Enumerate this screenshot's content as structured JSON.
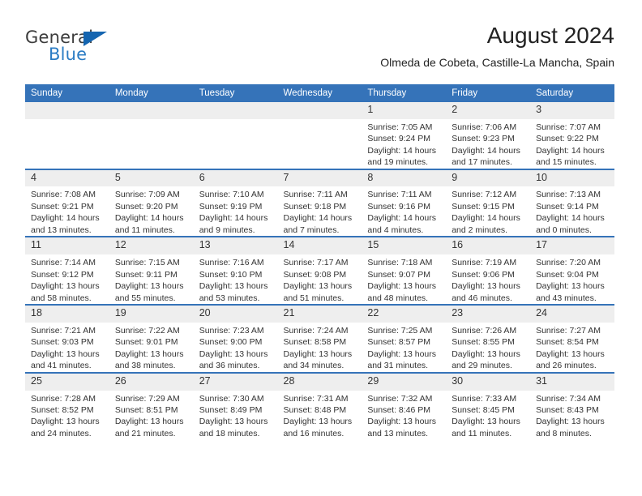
{
  "brand": {
    "name_part1": "General",
    "name_part2": "Blue",
    "triangle_color": "#1565b0",
    "blue_color": "#2b7cc4"
  },
  "header": {
    "title": "August 2024",
    "subtitle": "Olmeda de Cobeta, Castille-La Mancha, Spain"
  },
  "theme": {
    "header_blue": "#3573b9",
    "daynum_band": "#eeeeee",
    "text": "#333333"
  },
  "calendar": {
    "weekday_headers": [
      "Sunday",
      "Monday",
      "Tuesday",
      "Wednesday",
      "Thursday",
      "Friday",
      "Saturday"
    ],
    "weeks": [
      [
        {
          "day": "",
          "lines": []
        },
        {
          "day": "",
          "lines": []
        },
        {
          "day": "",
          "lines": []
        },
        {
          "day": "",
          "lines": []
        },
        {
          "day": "1",
          "lines": [
            "Sunrise: 7:05 AM",
            "Sunset: 9:24 PM",
            "Daylight: 14 hours",
            "and 19 minutes."
          ]
        },
        {
          "day": "2",
          "lines": [
            "Sunrise: 7:06 AM",
            "Sunset: 9:23 PM",
            "Daylight: 14 hours",
            "and 17 minutes."
          ]
        },
        {
          "day": "3",
          "lines": [
            "Sunrise: 7:07 AM",
            "Sunset: 9:22 PM",
            "Daylight: 14 hours",
            "and 15 minutes."
          ]
        }
      ],
      [
        {
          "day": "4",
          "lines": [
            "Sunrise: 7:08 AM",
            "Sunset: 9:21 PM",
            "Daylight: 14 hours",
            "and 13 minutes."
          ]
        },
        {
          "day": "5",
          "lines": [
            "Sunrise: 7:09 AM",
            "Sunset: 9:20 PM",
            "Daylight: 14 hours",
            "and 11 minutes."
          ]
        },
        {
          "day": "6",
          "lines": [
            "Sunrise: 7:10 AM",
            "Sunset: 9:19 PM",
            "Daylight: 14 hours",
            "and 9 minutes."
          ]
        },
        {
          "day": "7",
          "lines": [
            "Sunrise: 7:11 AM",
            "Sunset: 9:18 PM",
            "Daylight: 14 hours",
            "and 7 minutes."
          ]
        },
        {
          "day": "8",
          "lines": [
            "Sunrise: 7:11 AM",
            "Sunset: 9:16 PM",
            "Daylight: 14 hours",
            "and 4 minutes."
          ]
        },
        {
          "day": "9",
          "lines": [
            "Sunrise: 7:12 AM",
            "Sunset: 9:15 PM",
            "Daylight: 14 hours",
            "and 2 minutes."
          ]
        },
        {
          "day": "10",
          "lines": [
            "Sunrise: 7:13 AM",
            "Sunset: 9:14 PM",
            "Daylight: 14 hours",
            "and 0 minutes."
          ]
        }
      ],
      [
        {
          "day": "11",
          "lines": [
            "Sunrise: 7:14 AM",
            "Sunset: 9:12 PM",
            "Daylight: 13 hours",
            "and 58 minutes."
          ]
        },
        {
          "day": "12",
          "lines": [
            "Sunrise: 7:15 AM",
            "Sunset: 9:11 PM",
            "Daylight: 13 hours",
            "and 55 minutes."
          ]
        },
        {
          "day": "13",
          "lines": [
            "Sunrise: 7:16 AM",
            "Sunset: 9:10 PM",
            "Daylight: 13 hours",
            "and 53 minutes."
          ]
        },
        {
          "day": "14",
          "lines": [
            "Sunrise: 7:17 AM",
            "Sunset: 9:08 PM",
            "Daylight: 13 hours",
            "and 51 minutes."
          ]
        },
        {
          "day": "15",
          "lines": [
            "Sunrise: 7:18 AM",
            "Sunset: 9:07 PM",
            "Daylight: 13 hours",
            "and 48 minutes."
          ]
        },
        {
          "day": "16",
          "lines": [
            "Sunrise: 7:19 AM",
            "Sunset: 9:06 PM",
            "Daylight: 13 hours",
            "and 46 minutes."
          ]
        },
        {
          "day": "17",
          "lines": [
            "Sunrise: 7:20 AM",
            "Sunset: 9:04 PM",
            "Daylight: 13 hours",
            "and 43 minutes."
          ]
        }
      ],
      [
        {
          "day": "18",
          "lines": [
            "Sunrise: 7:21 AM",
            "Sunset: 9:03 PM",
            "Daylight: 13 hours",
            "and 41 minutes."
          ]
        },
        {
          "day": "19",
          "lines": [
            "Sunrise: 7:22 AM",
            "Sunset: 9:01 PM",
            "Daylight: 13 hours",
            "and 38 minutes."
          ]
        },
        {
          "day": "20",
          "lines": [
            "Sunrise: 7:23 AM",
            "Sunset: 9:00 PM",
            "Daylight: 13 hours",
            "and 36 minutes."
          ]
        },
        {
          "day": "21",
          "lines": [
            "Sunrise: 7:24 AM",
            "Sunset: 8:58 PM",
            "Daylight: 13 hours",
            "and 34 minutes."
          ]
        },
        {
          "day": "22",
          "lines": [
            "Sunrise: 7:25 AM",
            "Sunset: 8:57 PM",
            "Daylight: 13 hours",
            "and 31 minutes."
          ]
        },
        {
          "day": "23",
          "lines": [
            "Sunrise: 7:26 AM",
            "Sunset: 8:55 PM",
            "Daylight: 13 hours",
            "and 29 minutes."
          ]
        },
        {
          "day": "24",
          "lines": [
            "Sunrise: 7:27 AM",
            "Sunset: 8:54 PM",
            "Daylight: 13 hours",
            "and 26 minutes."
          ]
        }
      ],
      [
        {
          "day": "25",
          "lines": [
            "Sunrise: 7:28 AM",
            "Sunset: 8:52 PM",
            "Daylight: 13 hours",
            "and 24 minutes."
          ]
        },
        {
          "day": "26",
          "lines": [
            "Sunrise: 7:29 AM",
            "Sunset: 8:51 PM",
            "Daylight: 13 hours",
            "and 21 minutes."
          ]
        },
        {
          "day": "27",
          "lines": [
            "Sunrise: 7:30 AM",
            "Sunset: 8:49 PM",
            "Daylight: 13 hours",
            "and 18 minutes."
          ]
        },
        {
          "day": "28",
          "lines": [
            "Sunrise: 7:31 AM",
            "Sunset: 8:48 PM",
            "Daylight: 13 hours",
            "and 16 minutes."
          ]
        },
        {
          "day": "29",
          "lines": [
            "Sunrise: 7:32 AM",
            "Sunset: 8:46 PM",
            "Daylight: 13 hours",
            "and 13 minutes."
          ]
        },
        {
          "day": "30",
          "lines": [
            "Sunrise: 7:33 AM",
            "Sunset: 8:45 PM",
            "Daylight: 13 hours",
            "and 11 minutes."
          ]
        },
        {
          "day": "31",
          "lines": [
            "Sunrise: 7:34 AM",
            "Sunset: 8:43 PM",
            "Daylight: 13 hours",
            "and 8 minutes."
          ]
        }
      ]
    ]
  }
}
